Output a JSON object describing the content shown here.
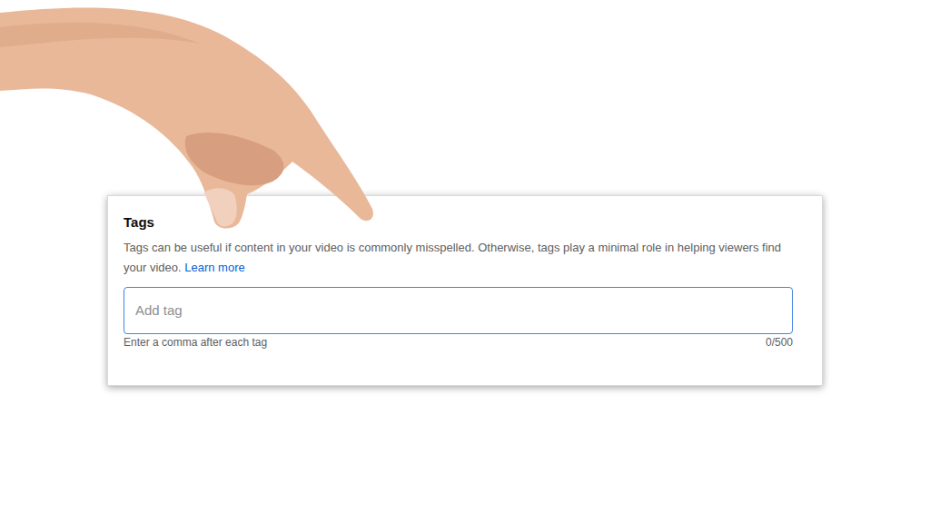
{
  "tags_field": {
    "title": "Tags",
    "description": "Tags can be useful if content in your video is commonly misspelled. Otherwise, tags play a minimal role in helping viewers find your video.",
    "link": "Learn more",
    "placeholder": "Add tag",
    "hint": "Enter a comma after each tag",
    "count": "0/500",
    "focused": true
  }
}
